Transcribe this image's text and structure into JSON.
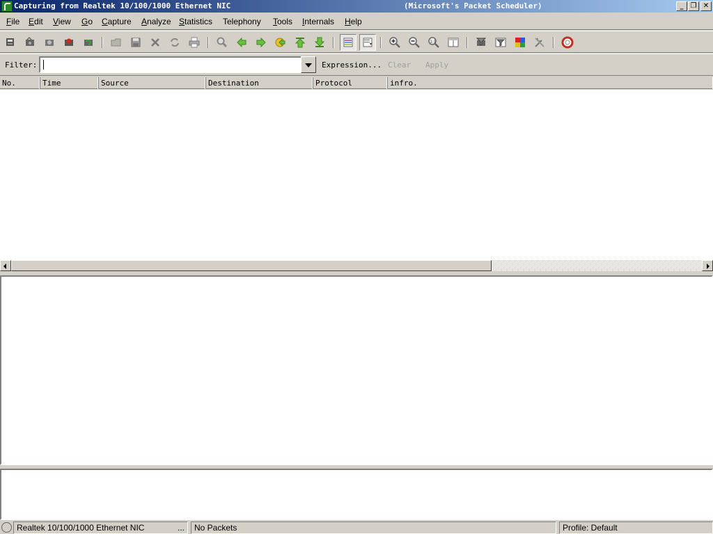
{
  "window": {
    "title": "Capturing from Realtek 10/100/1000 Ethernet NIC",
    "subtitle": "(Microsoft's Packet Scheduler)",
    "controls": {
      "minimize": "_",
      "restore": "❐",
      "close": "✕"
    }
  },
  "menu": [
    {
      "label": "File",
      "u": "F",
      "rest": "ile"
    },
    {
      "label": "Edit",
      "u": "E",
      "rest": "dit"
    },
    {
      "label": "View",
      "u": "V",
      "rest": "iew"
    },
    {
      "label": "Go",
      "u": "G",
      "rest": "o"
    },
    {
      "label": "Capture",
      "u": "C",
      "rest": "apture"
    },
    {
      "label": "Analyze",
      "u": "A",
      "rest": "nalyze"
    },
    {
      "label": "Statistics",
      "u": "S",
      "rest": "tatistics"
    },
    {
      "label": "Telephony",
      "u": "",
      "rest": "Telephony"
    },
    {
      "label": "Tools",
      "u": "T",
      "rest": "ools"
    },
    {
      "label": "Internals",
      "u": "I",
      "rest": "nternals"
    },
    {
      "label": "Help",
      "u": "H",
      "rest": "elp"
    }
  ],
  "toolbar": {
    "icons": [
      "interfaces-icon",
      "options-icon",
      "start-capture-icon",
      "stop-capture-icon",
      "restart-capture-icon",
      "open-file-icon",
      "save-file-icon",
      "close-file-icon",
      "reload-icon",
      "print-icon",
      "find-icon",
      "go-back-icon",
      "go-forward-icon",
      "go-to-packet-icon",
      "first-packet-icon",
      "last-packet-icon",
      "colorize-icon",
      "auto-scroll-icon",
      "zoom-in-icon",
      "zoom-out-icon",
      "normal-size-icon",
      "resize-columns-icon",
      "capture-filters-icon",
      "display-filters-icon",
      "coloring-rules-icon",
      "preferences-icon",
      "help-icon"
    ]
  },
  "filter": {
    "label": "Filter:",
    "value": "",
    "expression": "Expression...",
    "clear": "Clear",
    "apply": "Apply"
  },
  "packet_list": {
    "columns": [
      "No.",
      "Time",
      "Source",
      "Destination",
      "Protocol",
      "infro."
    ],
    "rows": []
  },
  "statusbar": {
    "interface": "Realtek 10/100/1000 Ethernet NIC",
    "more": "...",
    "packets": "No Packets",
    "profile": "Profile: Default"
  }
}
